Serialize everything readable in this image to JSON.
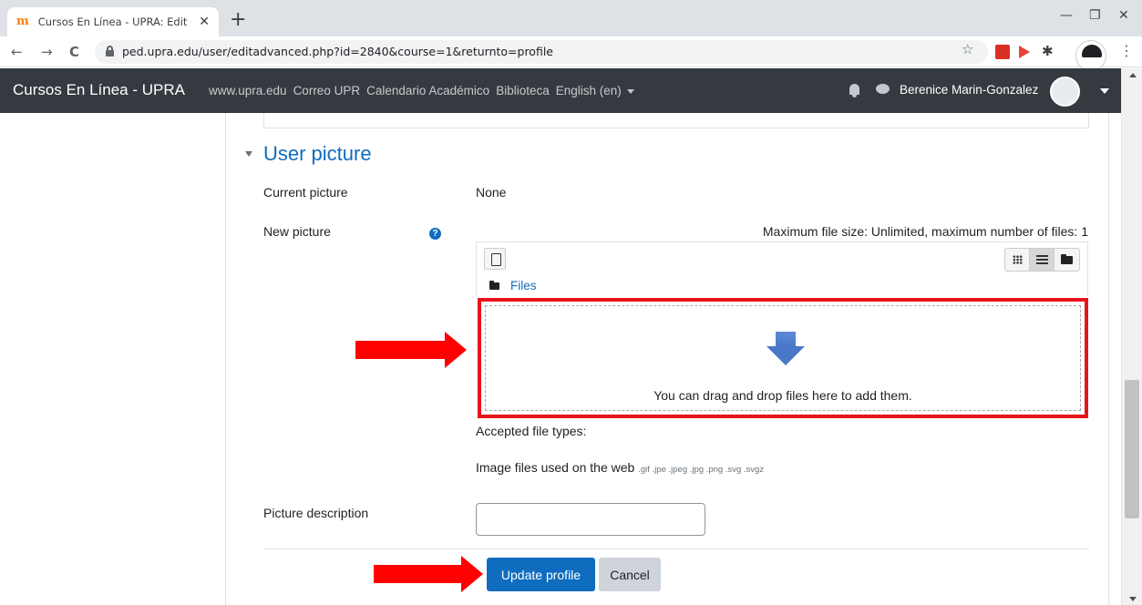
{
  "browser": {
    "tab_title": "Cursos En Línea - UPRA: Edit prof",
    "tab_close": "✕",
    "new_tab": "+",
    "url": "ped.upra.edu/user/editadvanced.php?id=2840&course=1&returnto=profile",
    "nav_back": "←",
    "nav_forward": "→",
    "nav_reload": "C",
    "bookmark": "☆",
    "extensions": "✱",
    "menu": "⋮",
    "win_min": "—",
    "win_restore": "❐",
    "win_close": "✕"
  },
  "navbar": {
    "brand": "Cursos En Línea - UPRA",
    "links": [
      "www.upra.edu",
      "Correo UPR",
      "Calendario Académico",
      "Biblioteca"
    ],
    "language": "English (en)",
    "user_name": "Berenice Marin-Gonzalez"
  },
  "section": {
    "title": "User picture",
    "current_picture_label": "Current picture",
    "current_picture_value": "None",
    "new_picture_label": "New picture",
    "help_glyph": "?",
    "max_file_size": "Maximum file size: Unlimited, maximum number of files: 1",
    "files_crumb": "Files",
    "drop_text": "You can drag and drop files here to add them.",
    "accepted_label": "Accepted file types:",
    "filetypes_main": "Image files used on the web",
    "filetypes_ext": ".gif .jpe .jpeg .jpg .png .svg .svgz",
    "picture_description_label": "Picture description",
    "picture_description_value": ""
  },
  "buttons": {
    "update_profile": "Update profile",
    "cancel": "Cancel"
  },
  "colors": {
    "primary": "#0f6cbf",
    "navbar": "#343a40",
    "annotation_red": "#ff0000"
  }
}
